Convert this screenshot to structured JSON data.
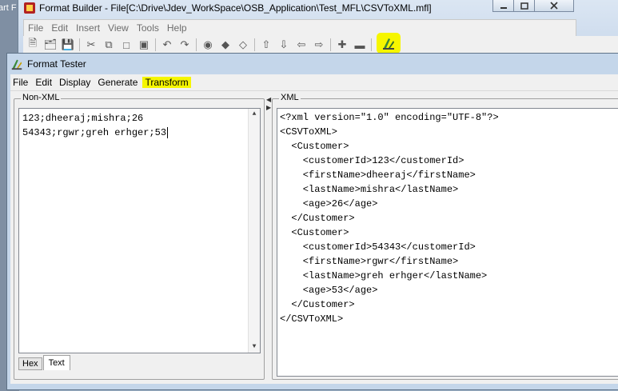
{
  "background_app": {
    "fragment": "art F"
  },
  "format_builder": {
    "title": "Format Builder - File[C:\\Drive\\Jdev_WorkSpace\\OSB_Application\\Test_MFL\\CSVToXML.mfl]",
    "menu": [
      "File",
      "Edit",
      "Insert",
      "View",
      "Tools",
      "Help"
    ],
    "highlight_color": "#f6f600"
  },
  "format_tester": {
    "title": "Format Tester",
    "menu": [
      "File",
      "Edit",
      "Display",
      "Generate",
      "Transform"
    ],
    "highlighted_menu": "Transform",
    "non_xml": {
      "label": "Non-XML",
      "lines": [
        "123;dheeraj;mishra;26",
        "54343;rgwr;greh erhger;53"
      ],
      "tabs": [
        "Hex",
        "Text"
      ],
      "active_tab": "Text"
    },
    "xml": {
      "label": "XML",
      "lines": [
        "<?xml version=\"1.0\" encoding=\"UTF-8\"?>",
        "<CSVToXML>",
        "  <Customer>",
        "    <customerId>123</customerId>",
        "    <firstName>dheeraj</firstName>",
        "    <lastName>mishra</lastName>",
        "    <age>26</age>",
        "  </Customer>",
        "  <Customer>",
        "    <customerId>54343</customerId>",
        "    <firstName>rgwr</firstName>",
        "    <lastName>greh erhger</lastName>",
        "    <age>53</age>",
        "  </Customer>",
        "</CSVToXML>"
      ]
    }
  }
}
